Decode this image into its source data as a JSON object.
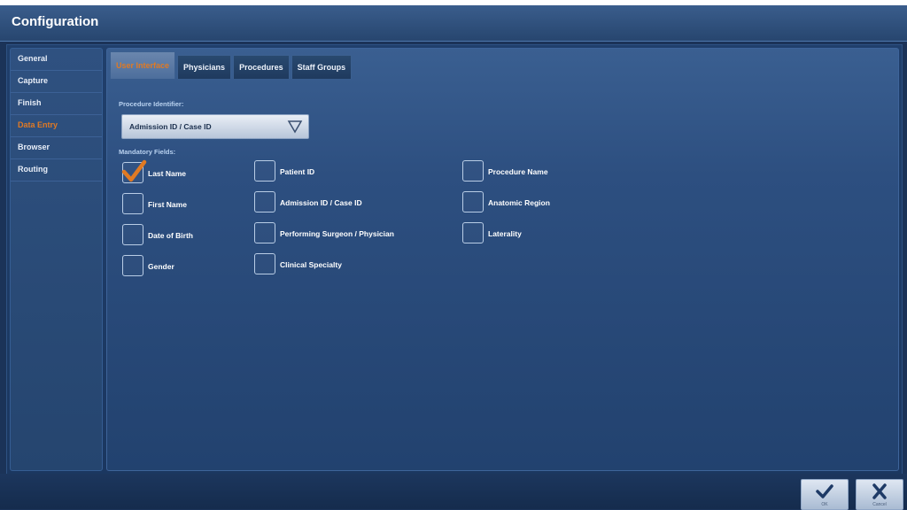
{
  "window": {
    "title": "Configuration"
  },
  "sidebar": {
    "items": [
      {
        "label": "General"
      },
      {
        "label": "Capture"
      },
      {
        "label": "Finish"
      },
      {
        "label": "Data Entry",
        "active": true
      },
      {
        "label": "Browser"
      },
      {
        "label": "Routing"
      }
    ]
  },
  "tabs": [
    {
      "label": "User Interface",
      "active": true
    },
    {
      "label": "Physicians"
    },
    {
      "label": "Procedures"
    },
    {
      "label": "Staff Groups"
    }
  ],
  "procedure_identifier": {
    "label": "Procedure Identifier:",
    "value": "Admission ID / Case ID"
  },
  "mandatory_fields": {
    "label": "Mandatory Fields:",
    "fields": [
      {
        "label": "Last Name",
        "checked": true
      },
      {
        "label": "First Name",
        "checked": false
      },
      {
        "label": "Date of Birth",
        "checked": false
      },
      {
        "label": "Gender",
        "checked": false
      },
      {
        "label": "Patient ID",
        "checked": false
      },
      {
        "label": "Admission ID / Case ID",
        "checked": false
      },
      {
        "label": "Performing Surgeon / Physician",
        "checked": false
      },
      {
        "label": "Clinical Specialty",
        "checked": false
      },
      {
        "label": "Procedure Name",
        "checked": false
      },
      {
        "label": "Anatomic Region",
        "checked": false
      },
      {
        "label": "Laterality",
        "checked": false
      }
    ]
  },
  "buttons": {
    "ok_label": "OK",
    "cancel_label": "Cancel"
  },
  "colors": {
    "accent": "#e07a24",
    "background": "#1b3358"
  },
  "icons": {
    "ok": "checkmark-icon",
    "cancel": "close-icon",
    "dropdown": "triangle-down-icon"
  }
}
